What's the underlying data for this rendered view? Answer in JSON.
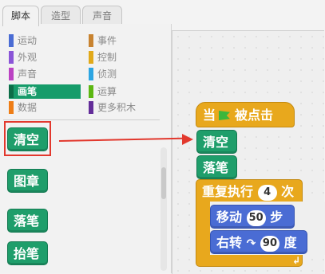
{
  "tabs": [
    {
      "label": "脚本",
      "active": true
    },
    {
      "label": "造型",
      "active": false
    },
    {
      "label": "声音",
      "active": false
    }
  ],
  "categories": [
    {
      "label": "运动",
      "color": "#4a6cd4"
    },
    {
      "label": "外观",
      "color": "#8a55d7"
    },
    {
      "label": "声音",
      "color": "#bb42c3"
    },
    {
      "label": "画笔",
      "color": "#169c6a",
      "selected": true
    },
    {
      "label": "数据",
      "color": "#ee7d16"
    },
    {
      "label": "事件",
      "color": "#c88330"
    },
    {
      "label": "控制",
      "color": "#e1a91a"
    },
    {
      "label": "侦测",
      "color": "#2ca5e2"
    },
    {
      "label": "运算",
      "color": "#5cb712"
    },
    {
      "label": "更多积木",
      "color": "#632d99"
    }
  ],
  "palette_blocks": [
    "清空",
    "图章",
    "落笔",
    "抬笔"
  ],
  "script": {
    "hat": "当",
    "hat_suffix": "被点击",
    "clear": "清空",
    "pen_down": "落笔",
    "repeat_label": "重复执行",
    "repeat_count": "4",
    "repeat_unit": "次",
    "move_label": "移动",
    "move_steps": "50",
    "move_unit": "步",
    "turn_label": "右转",
    "turn_degrees": "90",
    "turn_unit": "度"
  },
  "colors": {
    "pen": "#1f9e6b",
    "control": "#e8a81d",
    "motion": "#4a6cd4",
    "annotation": "#e2382d"
  }
}
